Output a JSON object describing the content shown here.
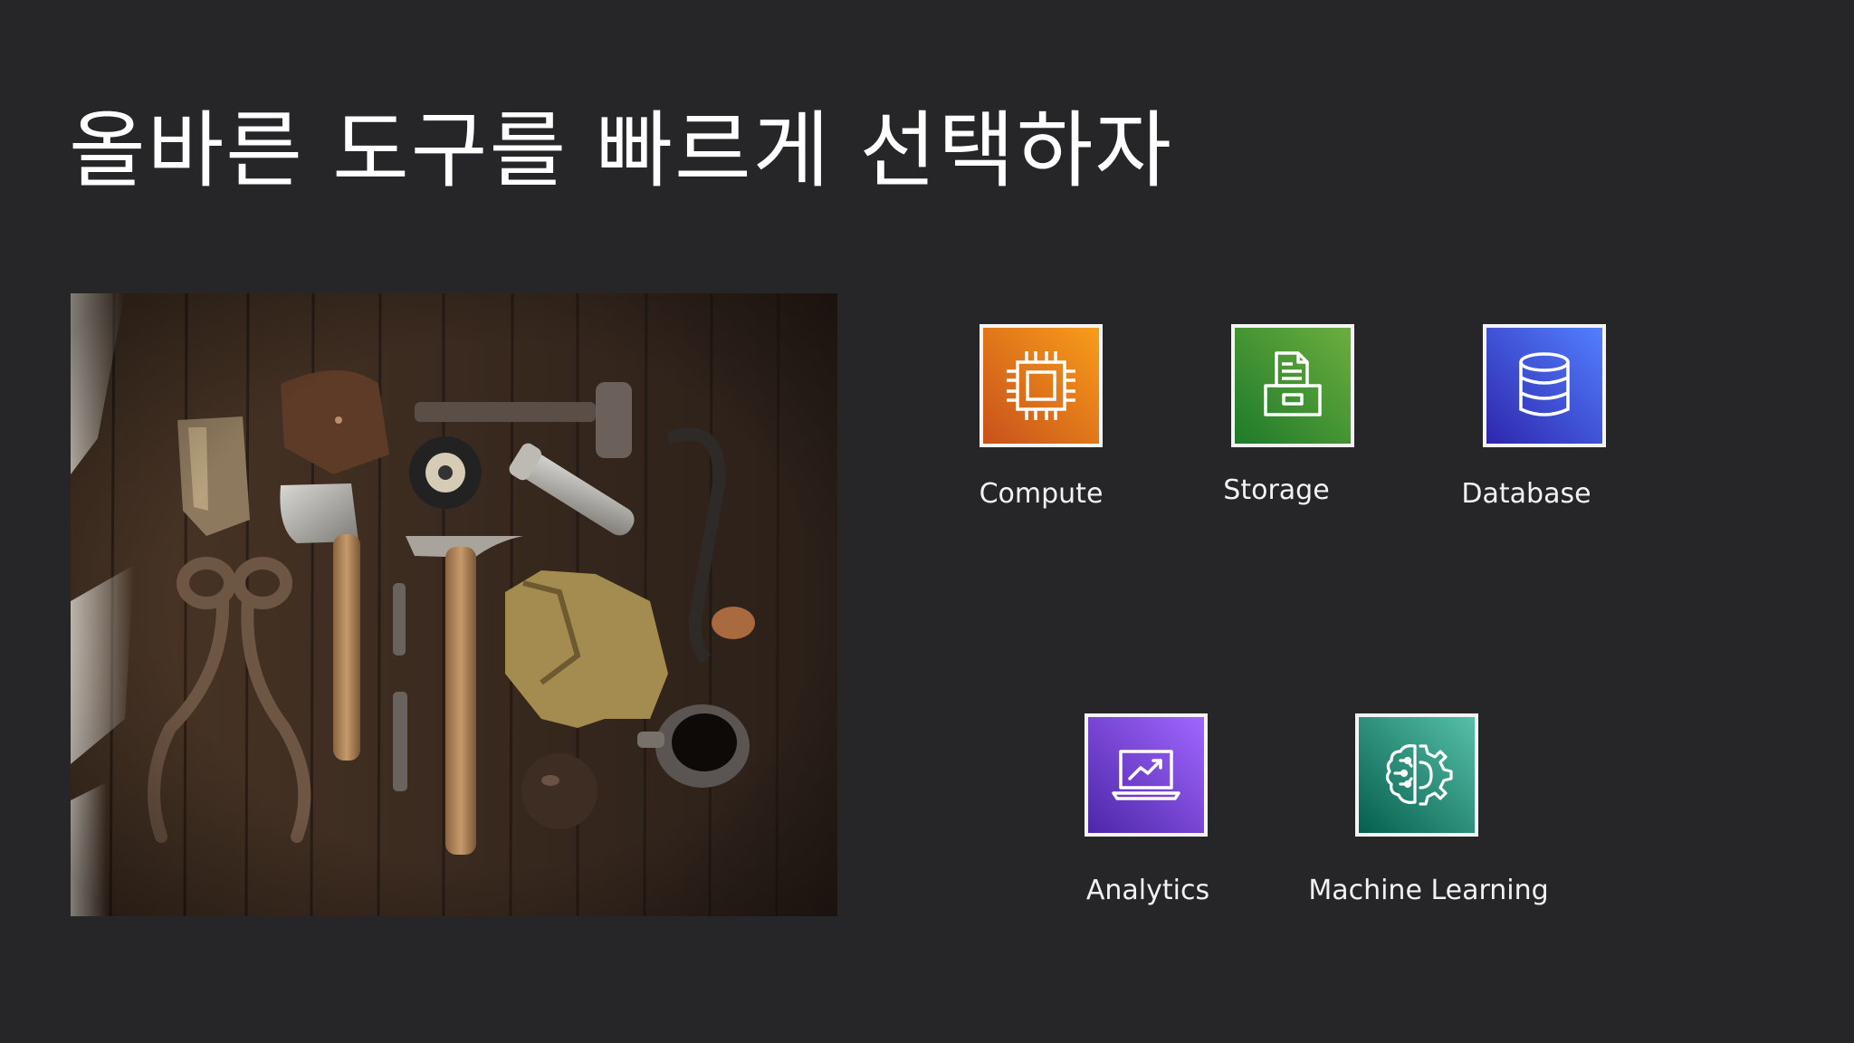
{
  "slide": {
    "title": "올바른 도구를 빠르게 선택하자"
  },
  "photo": {
    "subject": "tools-on-wooden-table"
  },
  "services": [
    {
      "label": "Compute",
      "icon": "chip-icon",
      "color_from": "#c8511b",
      "color_to": "#f89d1a"
    },
    {
      "label": "Storage",
      "icon": "file-cabinet-icon",
      "color_from": "#1e7a2a",
      "color_to": "#6cae3e"
    },
    {
      "label": "Database",
      "icon": "database-icon",
      "color_from": "#2e27ad",
      "color_to": "#527fff"
    },
    {
      "label": "Analytics",
      "icon": "chart-laptop-icon",
      "color_from": "#4d27a8",
      "color_to": "#a166ff"
    },
    {
      "label": "Machine Learning",
      "icon": "brain-gear-icon",
      "color_from": "#055f4e",
      "color_to": "#56c0a7"
    }
  ]
}
